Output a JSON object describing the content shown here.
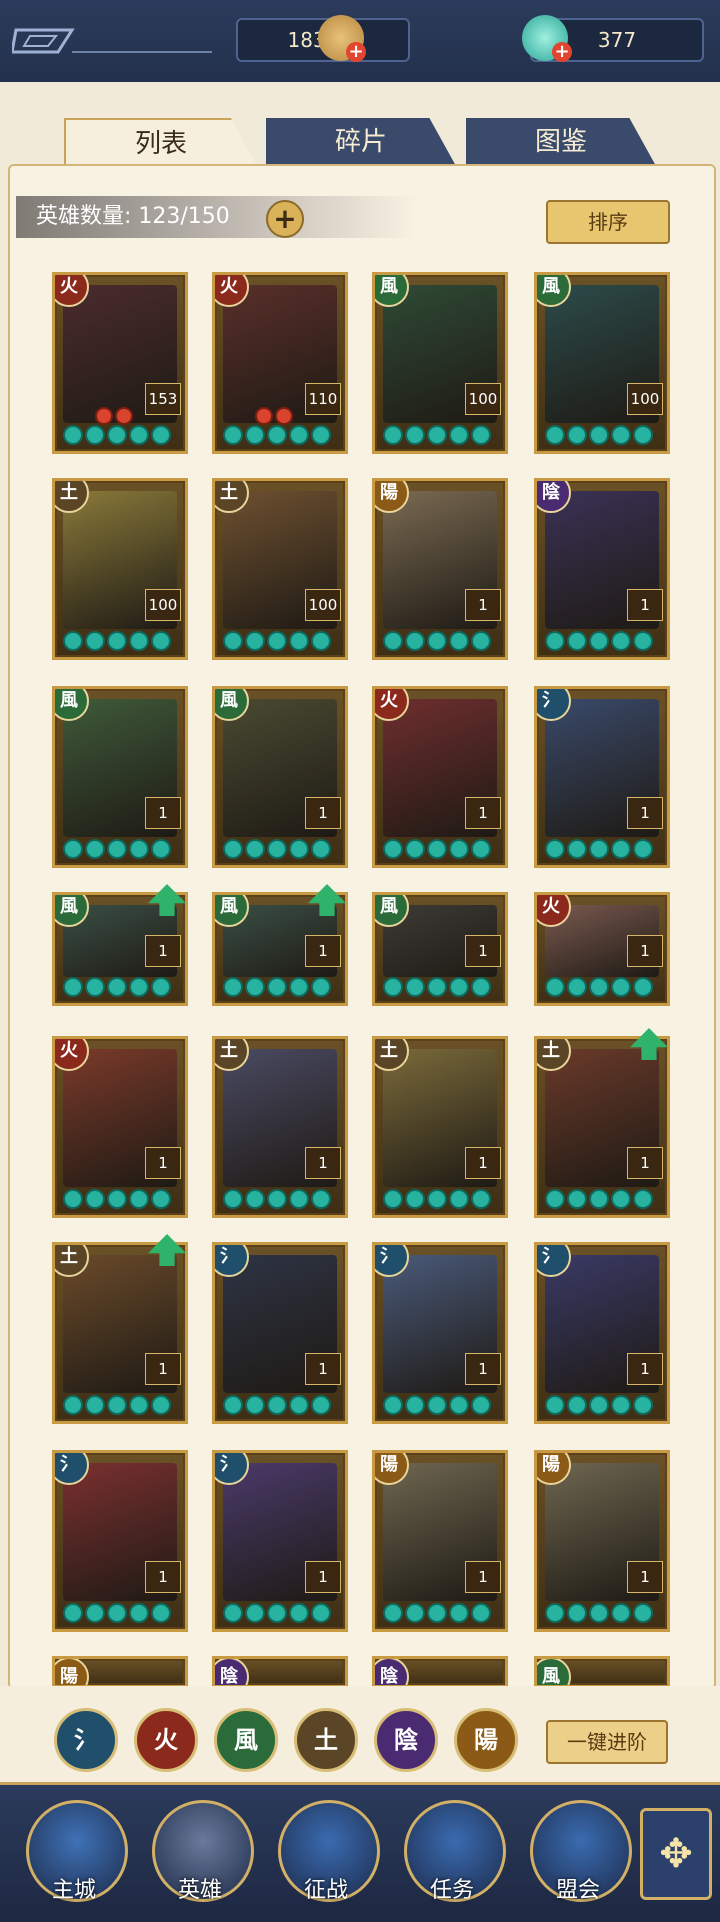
{
  "topbar": {
    "gold": "1837万",
    "gems": "377",
    "plus": "+"
  },
  "tabs": [
    {
      "label": "列表"
    },
    {
      "label": "碎片"
    },
    {
      "label": "图鉴"
    }
  ],
  "roster": {
    "count_text": "英雄数量: 123/150",
    "plus": "+",
    "sort_label": "排序"
  },
  "elements": {
    "water": "氵",
    "fire": "火",
    "wind": "風",
    "earth": "土",
    "yin": "陰",
    "yang": "陽"
  },
  "heroes": [
    {
      "elem": "火",
      "level": "153",
      "color": "#8b2a1c",
      "art": "#4b2b2e"
    },
    {
      "elem": "火",
      "level": "110",
      "color": "#8b2a1c",
      "art": "#5a2f2a"
    },
    {
      "elem": "風",
      "level": "100",
      "color": "#2b6b3a",
      "art": "#2f4a35"
    },
    {
      "elem": "風",
      "level": "100",
      "color": "#2b6b3a",
      "art": "#2c4b4a"
    },
    {
      "elem": "土",
      "level": "100",
      "color": "#5a4626",
      "art": "#8a7a3a"
    },
    {
      "elem": "土",
      "level": "100",
      "color": "#5a4626",
      "art": "#6e5030"
    },
    {
      "elem": "陽",
      "level": "1",
      "color": "#8a5a16",
      "art": "#7a6a52"
    },
    {
      "elem": "陰",
      "level": "1",
      "color": "#4a2a70",
      "art": "#3b3256"
    },
    {
      "elem": "風",
      "level": "1",
      "color": "#2b6b3a",
      "art": "#3f5a3a"
    },
    {
      "elem": "風",
      "level": "1",
      "color": "#2b6b3a",
      "art": "#4a4a32"
    },
    {
      "elem": "火",
      "level": "1",
      "color": "#8b2a1c",
      "art": "#6e2e2e"
    },
    {
      "elem": "氵",
      "level": "1",
      "color": "#1f4f6a",
      "art": "#3a4a6a"
    },
    {
      "elem": "風",
      "level": "1",
      "color": "#2b6b3a",
      "art": "#3a4f45"
    },
    {
      "elem": "風",
      "level": "1",
      "color": "#2b6b3a",
      "art": "#3a4f45"
    },
    {
      "elem": "風",
      "level": "1",
      "color": "#2b6b3a",
      "art": "#3e3a35"
    },
    {
      "elem": "火",
      "level": "1",
      "color": "#8b2a1c",
      "art": "#7a5a50"
    },
    {
      "elem": "火",
      "level": "1",
      "color": "#8b2a1c",
      "art": "#7a3a2a"
    },
    {
      "elem": "土",
      "level": "1",
      "color": "#5a4626",
      "art": "#4a4a62"
    },
    {
      "elem": "土",
      "level": "1",
      "color": "#5a4626",
      "art": "#7a6a3a"
    },
    {
      "elem": "土",
      "level": "1",
      "color": "#5a4626",
      "art": "#6a3a2a"
    },
    {
      "elem": "土",
      "level": "1",
      "color": "#5a4626",
      "art": "#6a4a2a"
    },
    {
      "elem": "氵",
      "level": "1",
      "color": "#1f4f6a",
      "art": "#2e3444"
    },
    {
      "elem": "氵",
      "level": "1",
      "color": "#1f4f6a",
      "art": "#4a5a7a"
    },
    {
      "elem": "氵",
      "level": "1",
      "color": "#1f4f6a",
      "art": "#3a3a66"
    },
    {
      "elem": "氵",
      "level": "1",
      "color": "#1f4f6a",
      "art": "#7a3030"
    },
    {
      "elem": "氵",
      "level": "1",
      "color": "#1f4f6a",
      "art": "#4a3a6a"
    },
    {
      "elem": "陽",
      "level": "1",
      "color": "#8a5a16",
      "art": "#6e6650"
    },
    {
      "elem": "陽",
      "level": "1",
      "color": "#8a5a16",
      "art": "#6e6650"
    }
  ],
  "partial_row": [
    {
      "elem": "陽"
    },
    {
      "elem": "陰"
    },
    {
      "elem": "陰"
    },
    {
      "elem": "風"
    }
  ],
  "filters": [
    "氵",
    "火",
    "風",
    "土",
    "陰",
    "陽"
  ],
  "advance_label": "一键进阶",
  "nav": [
    {
      "label": "主城"
    },
    {
      "label": "英雄"
    },
    {
      "label": "征战"
    },
    {
      "label": "任务"
    },
    {
      "label": "盟会"
    }
  ],
  "nav_more": "✥"
}
